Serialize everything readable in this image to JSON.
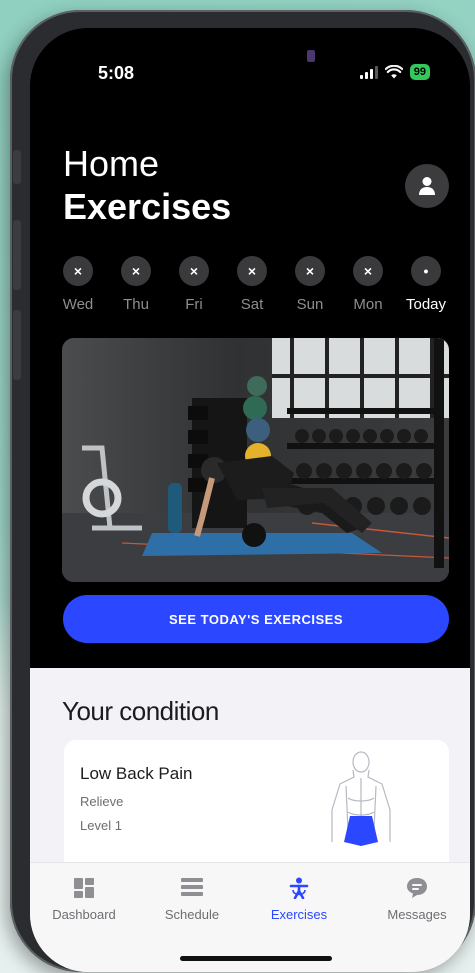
{
  "status": {
    "time": "5:08",
    "battery": "99"
  },
  "header": {
    "line1": "Home",
    "line2": "Exercises"
  },
  "days": [
    {
      "label": "Wed",
      "mark": "×"
    },
    {
      "label": "Thu",
      "mark": "×"
    },
    {
      "label": "Fri",
      "mark": "×"
    },
    {
      "label": "Sat",
      "mark": "×"
    },
    {
      "label": "Sun",
      "mark": "×"
    },
    {
      "label": "Mon",
      "mark": "×"
    },
    {
      "label": "Today",
      "mark": "•"
    }
  ],
  "cta": {
    "label": "SEE TODAY'S EXERCISES"
  },
  "condition": {
    "heading": "Your condition",
    "name": "Low Back Pain",
    "goal": "Relieve",
    "level": "Level 1"
  },
  "tabs": [
    {
      "label": "Dashboard",
      "icon": "dashboard-icon"
    },
    {
      "label": "Schedule",
      "icon": "schedule-icon"
    },
    {
      "label": "Exercises",
      "icon": "exercises-icon"
    },
    {
      "label": "Messages",
      "icon": "messages-icon"
    }
  ],
  "colors": {
    "accent": "#2b47ff",
    "battery": "#34c759",
    "highlight": "#2b47ff"
  }
}
